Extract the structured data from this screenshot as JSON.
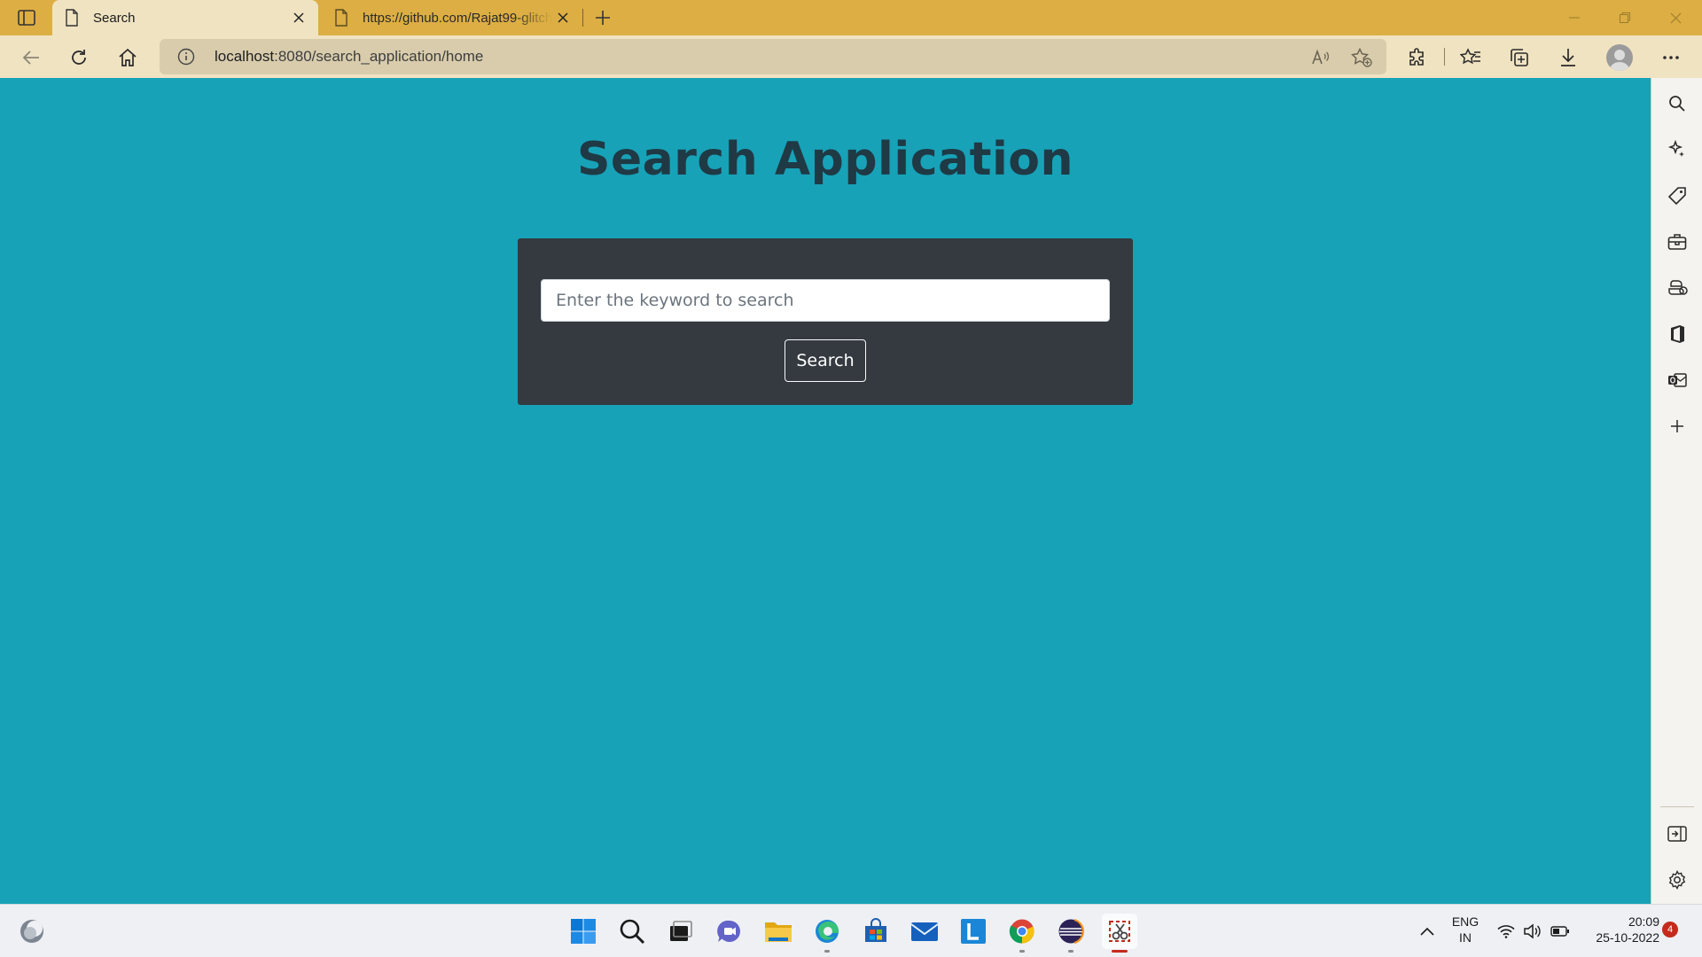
{
  "browser": {
    "tabs": [
      {
        "title": "Search",
        "active": true
      },
      {
        "title": "https://github.com/Rajat99-glitch",
        "active": false
      }
    ],
    "address_bar": {
      "host": "localhost",
      "rest": ":8080/search_application/home"
    }
  },
  "page": {
    "title": "Search Application",
    "search": {
      "placeholder": "Enter the keyword to search",
      "value": "",
      "button_label": "Search"
    },
    "colors": {
      "background": "#17a2b8",
      "card": "#343a40",
      "title_text": "#1f3a45"
    }
  },
  "sidebar": {
    "icons": [
      "search-icon",
      "copilot-icon",
      "shopping-tag-icon",
      "tools-icon",
      "games-icon",
      "office-icon",
      "outlook-icon",
      "add-icon",
      "hide-sidebar-icon",
      "settings-icon"
    ]
  },
  "taskbar": {
    "apps": [
      "weather-icon",
      "start-icon",
      "search-icon",
      "task-view-icon",
      "teams-chat-icon",
      "file-explorer-icon",
      "edge-icon",
      "store-icon",
      "mail-icon",
      "l-app-icon",
      "chrome-icon",
      "eclipse-icon",
      "snipping-tool-icon"
    ],
    "language": {
      "line1": "ENG",
      "line2": "IN"
    },
    "time": "20:09",
    "date": "25-10-2022",
    "notification_count": "4"
  }
}
